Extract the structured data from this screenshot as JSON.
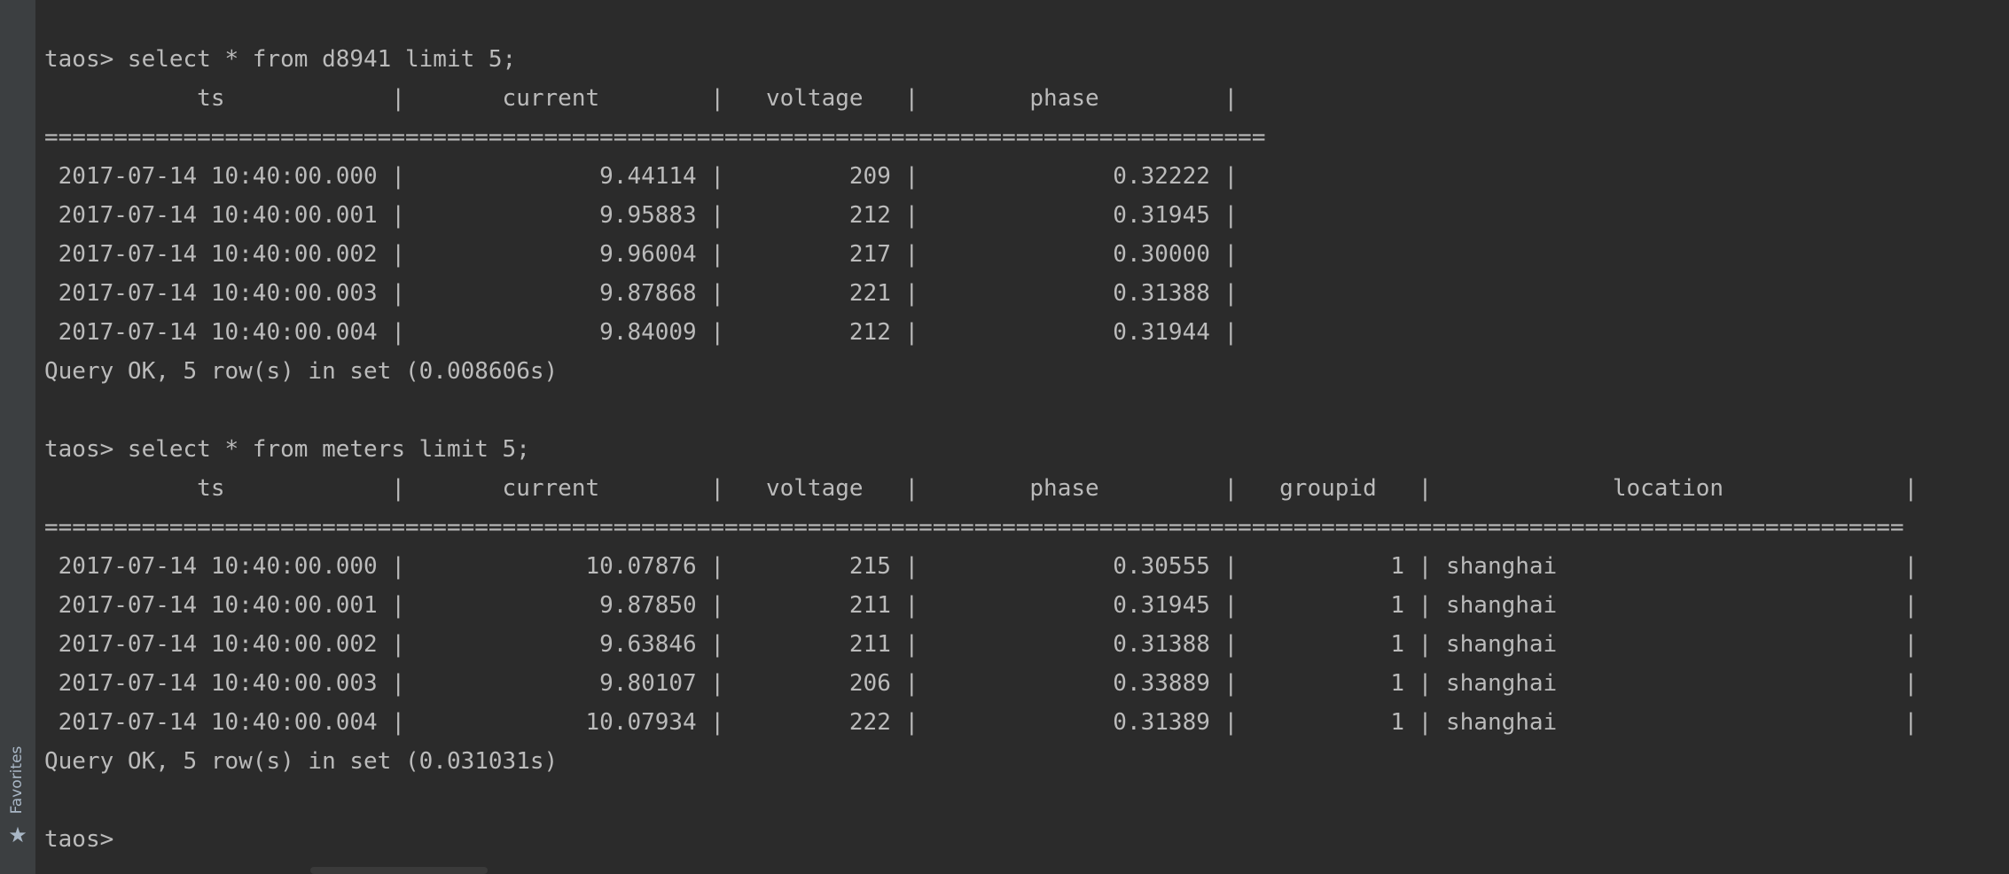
{
  "sidebar": {
    "favorites_label": "Favorites",
    "favorites_icon": "star-icon"
  },
  "terminal": {
    "lines": [
      "taos> select * from d8941 limit 5;",
      "           ts            |       current        |   voltage   |        phase         |",
      "========================================================================================",
      " 2017-07-14 10:40:00.000 |              9.44114 |         209 |              0.32222 |",
      " 2017-07-14 10:40:00.001 |              9.95883 |         212 |              0.31945 |",
      " 2017-07-14 10:40:00.002 |              9.96004 |         217 |              0.30000 |",
      " 2017-07-14 10:40:00.003 |              9.87868 |         221 |              0.31388 |",
      " 2017-07-14 10:40:00.004 |              9.84009 |         212 |              0.31944 |",
      "Query OK, 5 row(s) in set (0.008606s)",
      "",
      "taos> select * from meters limit 5;",
      "           ts            |       current        |   voltage   |        phase         |   groupid   |             location             |",
      "======================================================================================================================================",
      " 2017-07-14 10:40:00.000 |             10.07876 |         215 |              0.30555 |           1 | shanghai                         |",
      " 2017-07-14 10:40:00.001 |              9.87850 |         211 |              0.31945 |           1 | shanghai                         |",
      " 2017-07-14 10:40:00.002 |              9.63846 |         211 |              0.31388 |           1 | shanghai                         |",
      " 2017-07-14 10:40:00.003 |              9.80107 |         206 |              0.33889 |           1 | shanghai                         |",
      " 2017-07-14 10:40:00.004 |             10.07934 |         222 |              0.31389 |           1 | shanghai                         |",
      "Query OK, 5 row(s) in set (0.031031s)",
      "",
      "taos>"
    ]
  }
}
